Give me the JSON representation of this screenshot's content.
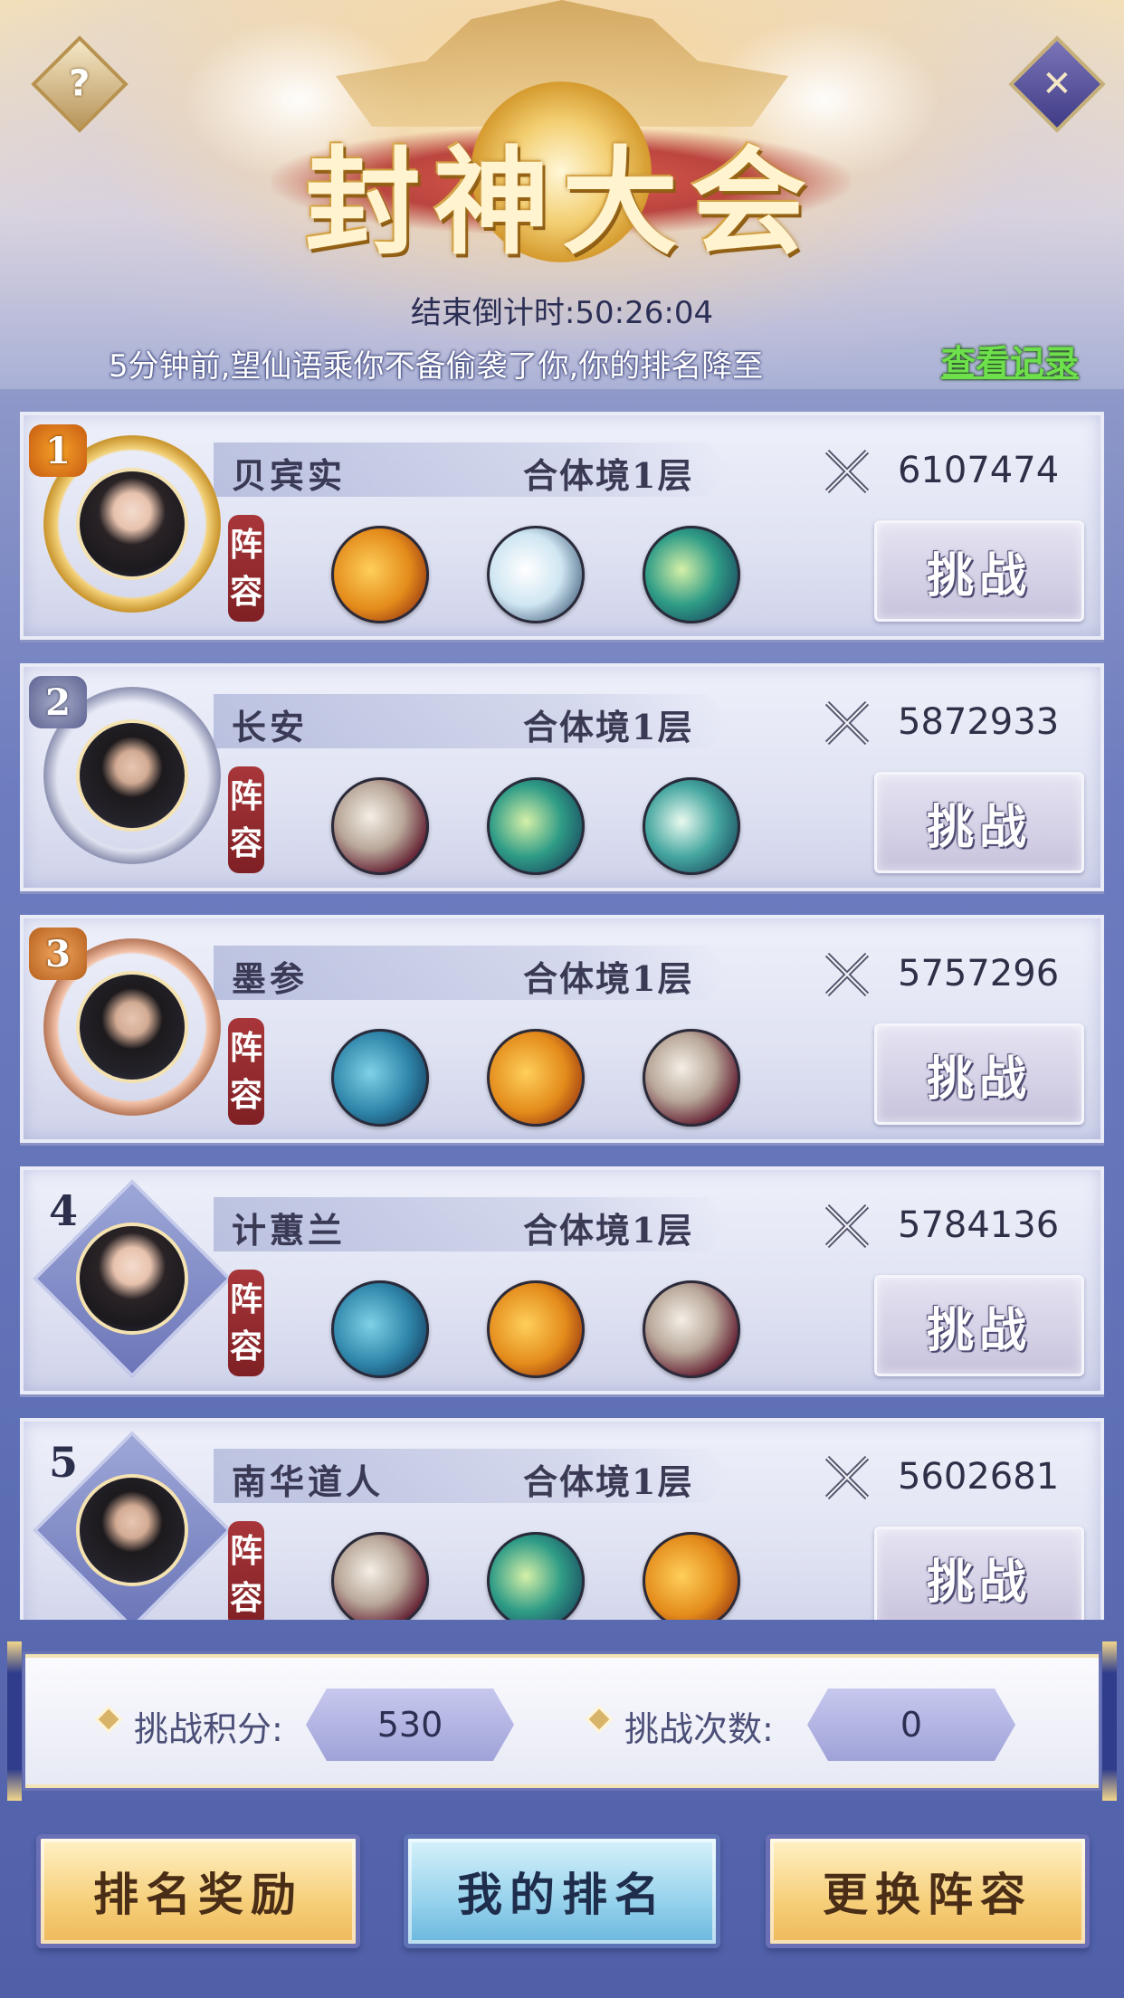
{
  "header": {
    "title": "封神大会",
    "countdown": "结束倒计时:50:26:04",
    "notice": "5分钟前,望仙语乘你不备偷袭了你,你的排名降至",
    "view_record": "查看记录",
    "help_icon_text": "?",
    "close_icon_text": "✕"
  },
  "ranking": [
    {
      "rank": "1",
      "name": "贝宾实",
      "realm": "合体境1层",
      "power": "6107474",
      "lineup_label_1": "阵",
      "lineup_label_2": "容",
      "challenge": "挑战",
      "frame": "gold",
      "pets": [
        "gold-dragon-pet",
        "white-dragon-pet",
        "teal-dragon-pet"
      ]
    },
    {
      "rank": "2",
      "name": "长安",
      "realm": "合体境1层",
      "power": "5872933",
      "lineup_label_1": "阵",
      "lineup_label_2": "容",
      "challenge": "挑战",
      "frame": "silver",
      "pets": [
        "bone-beast-pet",
        "teal-dragon-pet",
        "horned-beast-pet"
      ]
    },
    {
      "rank": "3",
      "name": "墨参",
      "realm": "合体境1层",
      "power": "5757296",
      "lineup_label_1": "阵",
      "lineup_label_2": "容",
      "challenge": "挑战",
      "frame": "bronze",
      "pets": [
        "blue-whale-pet",
        "gold-dragon-pet",
        "bone-beast-pet"
      ]
    },
    {
      "rank": "4",
      "name": "计蕙兰",
      "realm": "合体境1层",
      "power": "5784136",
      "lineup_label_1": "阵",
      "lineup_label_2": "容",
      "challenge": "挑战",
      "frame": "diamond",
      "pets": [
        "blue-whale-pet",
        "gold-dragon-pet",
        "bone-beast-pet"
      ]
    },
    {
      "rank": "5",
      "name": "南华道人",
      "realm": "合体境1层",
      "power": "5602681",
      "lineup_label_1": "阵",
      "lineup_label_2": "容",
      "challenge": "挑战",
      "frame": "diamond",
      "pets": [
        "bone-beast-pet",
        "teal-dragon-pet",
        "gold-dragon-pet"
      ]
    }
  ],
  "stats": {
    "score_label": "挑战积分:",
    "score_value": "530",
    "count_label": "挑战次数:",
    "count_value": "0"
  },
  "buttons": {
    "rank_reward": "排名奖励",
    "my_rank": "我的排名",
    "change_lineup": "更换阵容"
  }
}
